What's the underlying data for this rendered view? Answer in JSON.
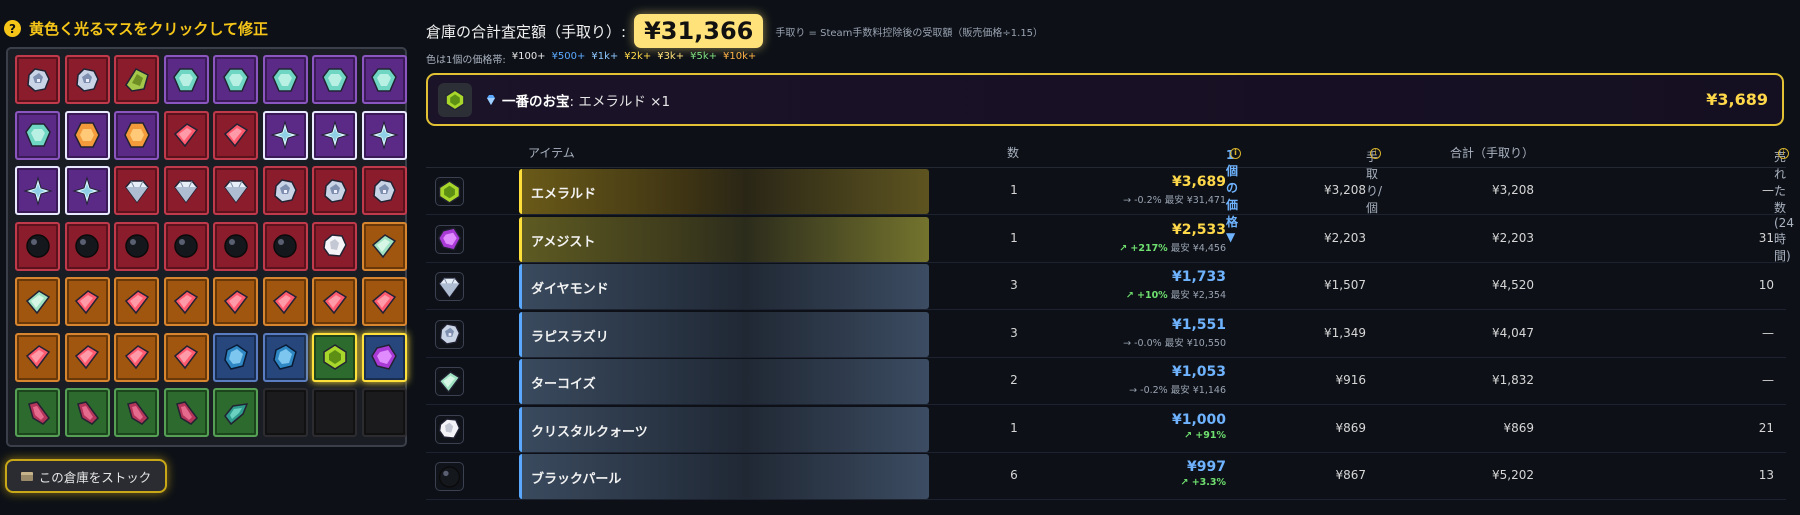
{
  "hint": {
    "icon": "?",
    "text": "黄色く光るマスをクリックして修正"
  },
  "inventory": {
    "cells": [
      {
        "gem": "lapis-icon",
        "rarity": "red"
      },
      {
        "gem": "lapis-icon",
        "rarity": "red"
      },
      {
        "gem": "peridot-icon",
        "rarity": "red"
      },
      {
        "gem": "turquoise-icon",
        "rarity": "purple"
      },
      {
        "gem": "turquoise-icon",
        "rarity": "purple"
      },
      {
        "gem": "turquoise-icon",
        "rarity": "purple"
      },
      {
        "gem": "turquoise-icon",
        "rarity": "purple"
      },
      {
        "gem": "turquoise-icon",
        "rarity": "purple"
      },
      {
        "gem": "turquoise-icon",
        "rarity": "purple"
      },
      {
        "gem": "topaz-icon",
        "rarity": "purple",
        "outline": "white"
      },
      {
        "gem": "topaz-icon",
        "rarity": "purple"
      },
      {
        "gem": "ruby-bar-icon",
        "rarity": "red"
      },
      {
        "gem": "ruby-bar-icon",
        "rarity": "red"
      },
      {
        "gem": "crystal-shard-icon",
        "rarity": "purple",
        "outline": "white"
      },
      {
        "gem": "crystal-shard-icon",
        "rarity": "purple",
        "outline": "white"
      },
      {
        "gem": "crystal-shard-icon",
        "rarity": "purple",
        "outline": "white"
      },
      {
        "gem": "crystal-shard-icon",
        "rarity": "purple",
        "outline": "white"
      },
      {
        "gem": "crystal-shard-icon",
        "rarity": "purple",
        "outline": "white"
      },
      {
        "gem": "diamond-icon",
        "rarity": "red"
      },
      {
        "gem": "diamond-icon",
        "rarity": "red"
      },
      {
        "gem": "diamond-icon",
        "rarity": "red"
      },
      {
        "gem": "lapis-icon",
        "rarity": "red"
      },
      {
        "gem": "lapis-icon",
        "rarity": "red"
      },
      {
        "gem": "lapis-icon",
        "rarity": "red"
      },
      {
        "gem": "black-pearl-icon",
        "rarity": "red"
      },
      {
        "gem": "black-pearl-icon",
        "rarity": "red"
      },
      {
        "gem": "black-pearl-icon",
        "rarity": "red"
      },
      {
        "gem": "black-pearl-icon",
        "rarity": "red"
      },
      {
        "gem": "black-pearl-icon",
        "rarity": "red"
      },
      {
        "gem": "black-pearl-icon",
        "rarity": "red"
      },
      {
        "gem": "crystal-quartz-icon",
        "rarity": "red"
      },
      {
        "gem": "turquoise-bar-icon",
        "rarity": "orange"
      },
      {
        "gem": "turquoise-bar-icon",
        "rarity": "orange"
      },
      {
        "gem": "ruby-bar-icon",
        "rarity": "orange"
      },
      {
        "gem": "ruby-bar-icon",
        "rarity": "orange"
      },
      {
        "gem": "ruby-bar-icon",
        "rarity": "orange"
      },
      {
        "gem": "ruby-bar-icon",
        "rarity": "orange"
      },
      {
        "gem": "ruby-bar-icon",
        "rarity": "orange"
      },
      {
        "gem": "ruby-bar-icon",
        "rarity": "orange"
      },
      {
        "gem": "ruby-bar-icon",
        "rarity": "orange"
      },
      {
        "gem": "ruby-bar-icon",
        "rarity": "orange"
      },
      {
        "gem": "ruby-bar-icon",
        "rarity": "orange"
      },
      {
        "gem": "ruby-bar-icon",
        "rarity": "orange"
      },
      {
        "gem": "ruby-bar-icon",
        "rarity": "orange"
      },
      {
        "gem": "sapphire-icon",
        "rarity": "blue"
      },
      {
        "gem": "sapphire-icon",
        "rarity": "blue"
      },
      {
        "gem": "emerald-icon",
        "rarity": "green",
        "outline": "yellow"
      },
      {
        "gem": "amethyst-icon",
        "rarity": "blue",
        "outline": "yellow"
      },
      {
        "gem": "garnet-shard-icon",
        "rarity": "green"
      },
      {
        "gem": "garnet-shard-icon",
        "rarity": "green"
      },
      {
        "gem": "garnet-shard-icon",
        "rarity": "green"
      },
      {
        "gem": "garnet-shard-icon",
        "rarity": "green"
      },
      {
        "gem": "teal-shard-icon",
        "rarity": "green"
      },
      {
        "gem": "empty",
        "rarity": "empty"
      },
      {
        "gem": "empty",
        "rarity": "empty"
      },
      {
        "gem": "empty",
        "rarity": "empty"
      }
    ]
  },
  "stock_button": {
    "icon": "box-icon",
    "label": "この倉庫をストック"
  },
  "summary": {
    "label": "倉庫の合計査定額（手取り）:",
    "total": "¥31,366",
    "note": "手取り = Steam手数料控除後の受取額（販売価格÷1.15）"
  },
  "legend": {
    "prefix": "色は1個の価格帯:",
    "tiers": [
      "¥100+",
      "¥500+",
      "¥1k+",
      "¥2k+",
      "¥3k+",
      "¥5k+",
      "¥10k+"
    ]
  },
  "treasure": {
    "icon": "emerald-icon",
    "badge_icon": "diamond-icon",
    "label": "一番のお宝",
    "name": ": エメラルド ×1",
    "price": "¥3,689"
  },
  "table": {
    "headers": {
      "item": "アイテム",
      "qty": "数",
      "price": "1個の価格 ▼",
      "net": "手取り/個",
      "total": "合計（手取り）",
      "sold": "売れた数(24時間)"
    },
    "rows": [
      {
        "icon": "emerald-icon",
        "name": "エメラルド",
        "style": "gold",
        "qty": "1",
        "price": "¥3,689",
        "price_color": "gold",
        "trend": "→ -0.2%",
        "trend_up": false,
        "low": "最安 ¥31,471",
        "net": "¥3,208",
        "total": "¥3,208",
        "sold": "—"
      },
      {
        "icon": "amethyst-icon",
        "name": "アメジスト",
        "style": "olive",
        "qty": "1",
        "price": "¥2,533",
        "price_color": "gold",
        "trend": "↗ +217%",
        "trend_up": true,
        "low": "最安 ¥4,456",
        "net": "¥2,203",
        "total": "¥2,203",
        "sold": "31"
      },
      {
        "icon": "diamond-icon",
        "name": "ダイヤモンド",
        "style": "blue",
        "qty": "3",
        "price": "¥1,733",
        "price_color": "blue",
        "trend": "↗ +10%",
        "trend_up": true,
        "low": "最安 ¥2,354",
        "net": "¥1,507",
        "total": "¥4,520",
        "sold": "10"
      },
      {
        "icon": "lapis-icon",
        "name": "ラピスラズリ",
        "style": "blue",
        "qty": "3",
        "price": "¥1,551",
        "price_color": "blue",
        "trend": "→ -0.0%",
        "trend_up": false,
        "low": "最安 ¥10,550",
        "net": "¥1,349",
        "total": "¥4,047",
        "sold": "—"
      },
      {
        "icon": "turquoise-bar-icon",
        "name": "ターコイズ",
        "style": "blue",
        "qty": "2",
        "price": "¥1,053",
        "price_color": "blue",
        "trend": "→ -0.2%",
        "trend_up": false,
        "low": "最安 ¥1,146",
        "net": "¥916",
        "total": "¥1,832",
        "sold": "—"
      },
      {
        "icon": "crystal-quartz-icon",
        "name": "クリスタルクォーツ",
        "style": "blue",
        "qty": "1",
        "price": "¥1,000",
        "price_color": "blue",
        "trend": "↗ +91%",
        "trend_up": true,
        "low": "",
        "net": "¥869",
        "total": "¥869",
        "sold": "21"
      },
      {
        "icon": "black-pearl-icon",
        "name": "ブラックパール",
        "style": "blue",
        "qty": "6",
        "price": "¥997",
        "price_color": "blue",
        "trend": "↗ +3.3%",
        "trend_up": true,
        "low": "",
        "net": "¥867",
        "total": "¥5,202",
        "sold": "13"
      }
    ]
  }
}
